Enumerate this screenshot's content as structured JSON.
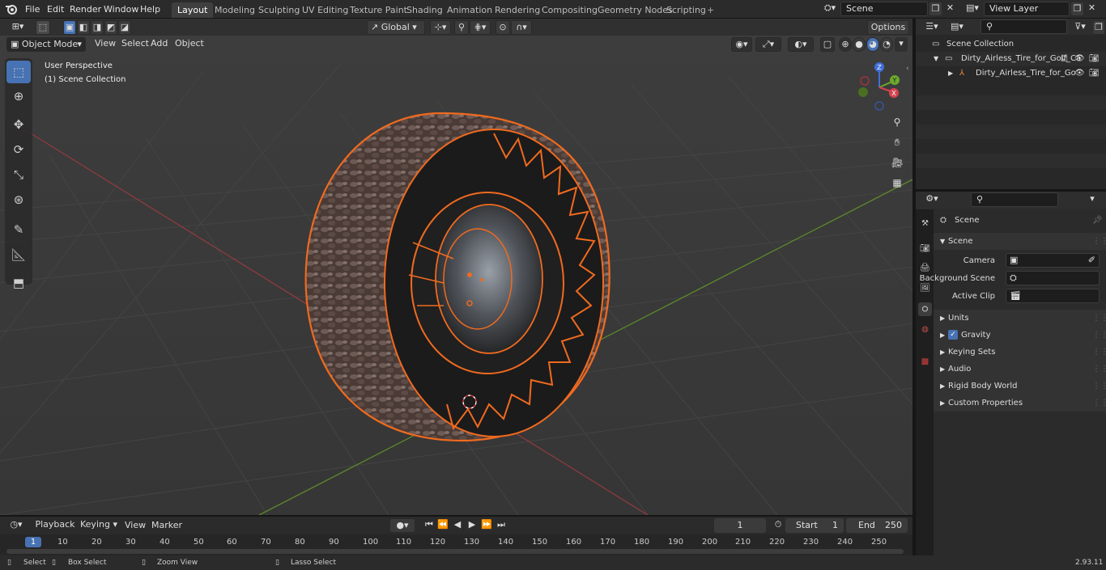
{
  "topbar": {
    "menus": [
      "File",
      "Edit",
      "Render",
      "Window",
      "Help"
    ],
    "workspaces": [
      "Layout",
      "Modeling",
      "Sculpting",
      "UV Editing",
      "Texture Paint",
      "Shading",
      "Animation",
      "Rendering",
      "Compositing",
      "Geometry Nodes",
      "Scripting"
    ],
    "active_workspace": "Layout",
    "scene_name": "Scene",
    "view_layer": "View Layer"
  },
  "viewport_header": {
    "mode": "Object Mode",
    "menus": [
      "View",
      "Select",
      "Add",
      "Object"
    ],
    "transform_orientation": "Global",
    "options_label": "Options"
  },
  "viewport": {
    "perspective_label": "User Perspective",
    "collection_label": "(1) Scene Collection",
    "gizmo_axes": {
      "x": "X",
      "y": "Y",
      "z": "Z"
    }
  },
  "outliner": {
    "root": "Scene Collection",
    "items": [
      {
        "label": "Dirty_Airless_Tire_for_Golf_Ca",
        "level": 1
      },
      {
        "label": "Dirty_Airless_Tire_for_Go",
        "level": 2
      }
    ]
  },
  "properties": {
    "context_label": "Scene",
    "section_title": "Scene",
    "fields": [
      {
        "label": "Camera",
        "value": ""
      },
      {
        "label": "Background Scene",
        "value": ""
      },
      {
        "label": "Active Clip",
        "value": ""
      }
    ],
    "panels": [
      "Units",
      "Gravity",
      "Keying Sets",
      "Audio",
      "Rigid Body World",
      "Custom Properties"
    ],
    "gravity_checked": true
  },
  "timeline": {
    "menus": [
      "Playback",
      "Keying",
      "View",
      "Marker"
    ],
    "current_frame": "1",
    "start_label": "Start",
    "start_value": "1",
    "end_label": "End",
    "end_value": "250",
    "ruler": [
      "1",
      "10",
      "20",
      "30",
      "40",
      "50",
      "60",
      "70",
      "80",
      "90",
      "100",
      "110",
      "120",
      "130",
      "140",
      "150",
      "160",
      "170",
      "180",
      "190",
      "200",
      "210",
      "220",
      "230",
      "240",
      "250"
    ]
  },
  "statusbar": {
    "select": "Select",
    "box_select": "Box Select",
    "zoom_view": "Zoom View",
    "lasso_select": "Lasso Select",
    "version": "2.93.11"
  },
  "colors": {
    "accent": "#4772b3",
    "selection_outline": "#f06a1f",
    "x_axis": "#b23b45",
    "y_axis": "#6c9a2b"
  }
}
